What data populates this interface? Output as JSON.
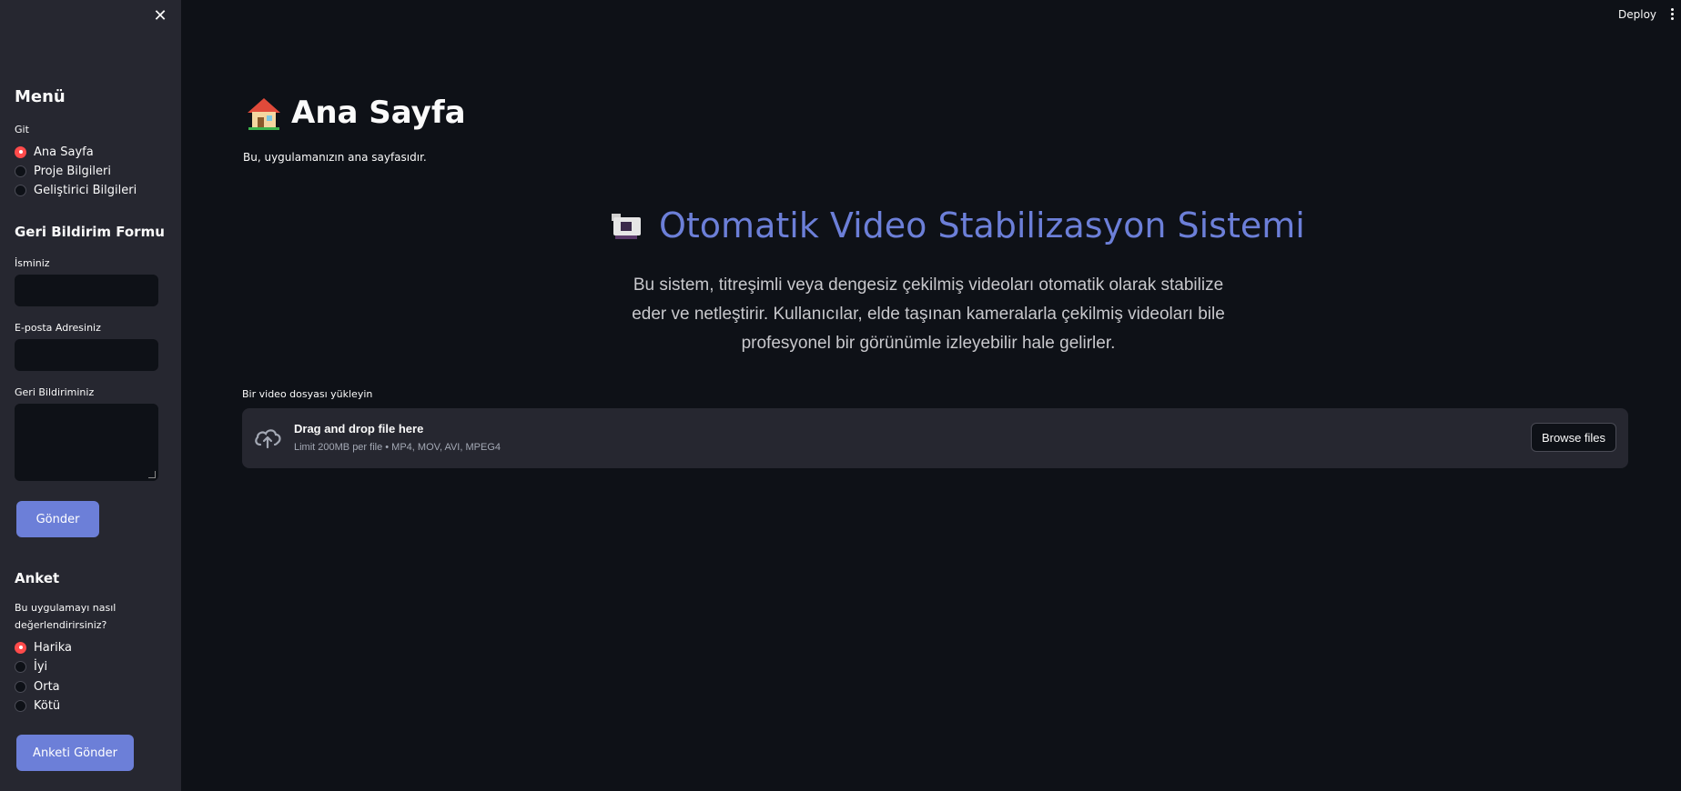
{
  "sidebar": {
    "menu_title": "Menü",
    "nav_label": "Git",
    "nav_options": [
      {
        "label": "Ana Sayfa",
        "selected": true
      },
      {
        "label": "Proje Bilgileri",
        "selected": false
      },
      {
        "label": "Geliştirici Bilgileri",
        "selected": false
      }
    ],
    "feedback_title": "Geri Bildirim Formu",
    "name_label": "İsminiz",
    "email_label": "E-posta Adresiniz",
    "feedback_label": "Geri Bildiriminiz",
    "send_button": "Gönder",
    "survey_title": "Anket",
    "survey_question_line1": "Bu uygulamayı nasıl",
    "survey_question_line2": "değerlendirirsiniz?",
    "survey_options": [
      {
        "label": "Harika",
        "selected": true
      },
      {
        "label": "İyi",
        "selected": false
      },
      {
        "label": "Orta",
        "selected": false
      },
      {
        "label": "Kötü",
        "selected": false
      }
    ],
    "survey_button": "Anketi Gönder"
  },
  "topbar": {
    "deploy_label": "Deploy"
  },
  "main": {
    "title": "Ana Sayfa",
    "subtitle": "Bu, uygulamanızın ana sayfasıdır.",
    "hero_title": "Otomatik Video Stabilizasyon Sistemi",
    "hero_description_line1": "Bu sistem, titreşimli veya dengesiz çekilmiş videoları otomatik olarak stabilize",
    "hero_description_line2": "eder ve netleştirir. Kullanıcılar, elde taşınan kameralarla çekilmiş videoları bile",
    "hero_description_line3": "profesyonel bir görünümle izleyebilir hale gelirler.",
    "uploader_label": "Bir video dosyası yükleyin",
    "uploader_title": "Drag and drop file here",
    "uploader_limit": "Limit 200MB per file • MP4, MOV, AVI, MPEG4",
    "browse_button": "Browse files"
  },
  "colors": {
    "accent": "#6c7fd8",
    "radio_selected": "#ff4b4b",
    "background": "#0e1117",
    "sidebar": "#262730"
  }
}
